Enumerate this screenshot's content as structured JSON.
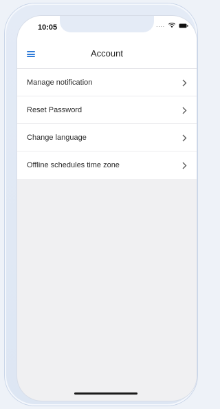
{
  "status_bar": {
    "time": "10:05",
    "signal": "....",
    "icons": [
      "wifi-icon",
      "battery-icon"
    ]
  },
  "header": {
    "title": "Account",
    "menu_icon": "hamburger-menu-icon",
    "accent_color": "#2f7bd9"
  },
  "menu": {
    "items": [
      {
        "label": "Manage notification",
        "icon": "chevron-right-icon"
      },
      {
        "label": "Reset Password",
        "icon": "chevron-right-icon"
      },
      {
        "label": "Change language",
        "icon": "chevron-right-icon"
      },
      {
        "label": "Offline schedules time zone",
        "icon": "chevron-right-icon"
      }
    ]
  }
}
